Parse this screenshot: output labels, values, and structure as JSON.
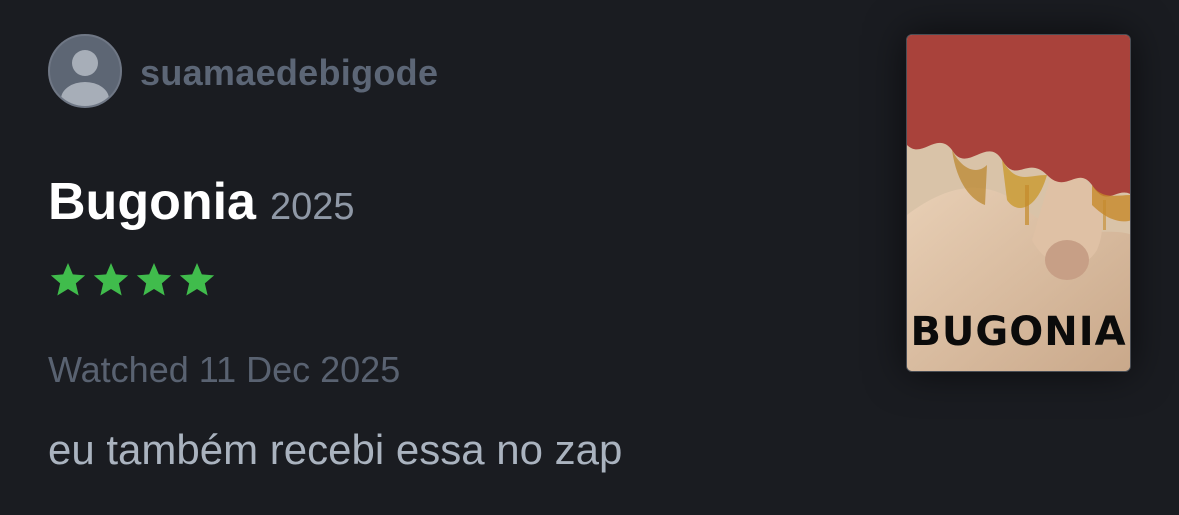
{
  "user": {
    "username": "suamaedebigode",
    "avatar_icon": "default-user-avatar-icon"
  },
  "film": {
    "title": "Bugonia",
    "year": "2025",
    "poster_title": "BUGONIA"
  },
  "rating": {
    "stars": 4,
    "max_stars": 5,
    "star_color": "#40bc4c",
    "star_icon": "star-icon"
  },
  "watched": {
    "label": "Watched 11 Dec 2025"
  },
  "review": {
    "text": "eu também recebi essa no zap"
  },
  "colors": {
    "background": "#1a1c21",
    "title": "#ffffff",
    "muted": "#596271"
  }
}
